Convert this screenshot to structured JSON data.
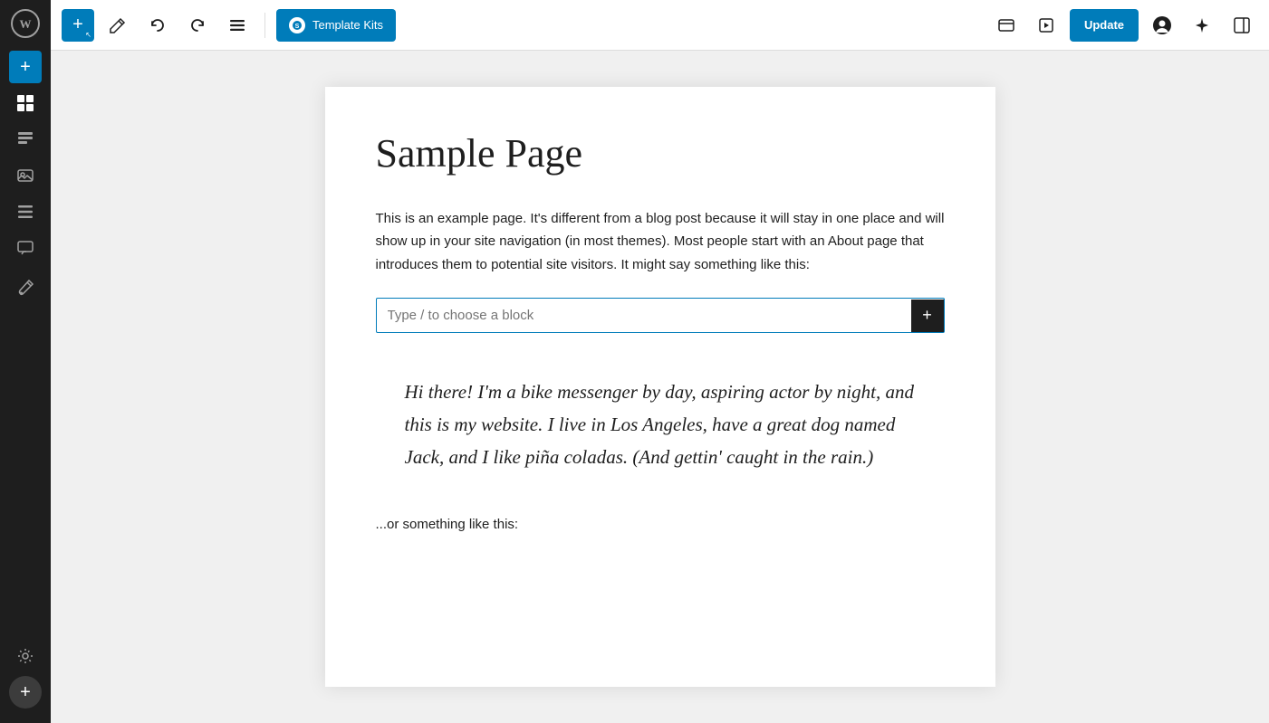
{
  "sidebar": {
    "icons": [
      {
        "name": "wp-logo",
        "symbol": "W"
      },
      {
        "name": "blocks-icon",
        "symbol": "⊞"
      },
      {
        "name": "patterns-icon",
        "symbol": "▤"
      },
      {
        "name": "media-icon",
        "symbol": "🖼"
      },
      {
        "name": "layers-icon",
        "symbol": "≡"
      },
      {
        "name": "comments-icon",
        "symbol": "💬"
      },
      {
        "name": "brush-icon",
        "symbol": "✏"
      },
      {
        "name": "settings-icon",
        "symbol": "⚙"
      }
    ],
    "add_button_label": "+"
  },
  "toolbar": {
    "add_button_label": "+",
    "edit_icon_label": "✏",
    "undo_label": "↩",
    "redo_label": "↪",
    "tools_label": "≡",
    "template_kits_label": "Template Kits",
    "view_icon_label": "□",
    "preview_icon_label": "⬜",
    "update_label": "Update",
    "avatar_icon_label": "👤",
    "ai_icon_label": "✦",
    "panel_icon_label": "▤"
  },
  "editor": {
    "page_title": "Sample Page",
    "paragraph1": "This is an example page. It's different from a blog post because it will stay in one place and will show up in your site navigation (in most themes). Most people start with an About page that introduces them to potential site visitors. It might say something like this:",
    "block_input_placeholder": "Type / to choose a block",
    "quote_text": "Hi there! I'm a bike messenger by day, aspiring actor by night, and this is my website. I live in Los Angeles, have a great dog named Jack, and I like piña coladas. (And gettin' caught in the rain.)",
    "or_text": "...or something like this:"
  },
  "colors": {
    "blue": "#007cba",
    "dark": "#1e1e1e",
    "white": "#ffffff",
    "light_gray": "#f0f0f0",
    "mid_gray": "#ddd",
    "text_gray": "#757575"
  }
}
